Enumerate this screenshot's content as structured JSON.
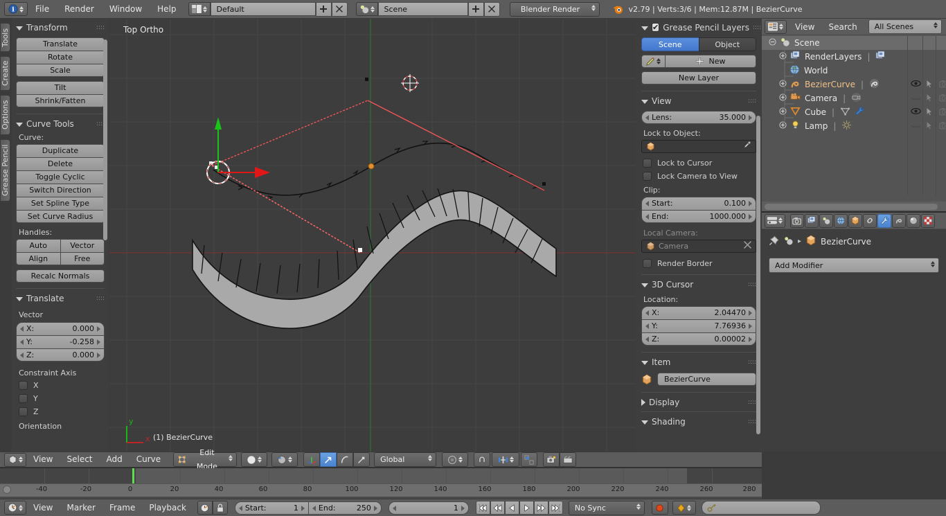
{
  "app": {
    "title": "Blender",
    "version_info": "v2.79 | Verts:3/6 | Mem:12.87M | BezierCurve",
    "logo_icon": "blender-logo-icon"
  },
  "topbar": {
    "editor_type_icon": "info-editor-icon",
    "menus": [
      "File",
      "Render",
      "Window",
      "Help"
    ],
    "screen_layout_icon": "screen-layout-icon",
    "screen_layout": "Default",
    "add_screen_icon": "plus-icon",
    "delete_screen_icon": "x-icon",
    "scene_icon": "scene-icon",
    "scene": "Scene",
    "add_scene_icon": "plus-icon",
    "delete_scene_icon": "x-icon",
    "render_engine": "Blender Render"
  },
  "tool_tabs": [
    "Tools",
    "Create",
    "Options",
    "Grease Pencil"
  ],
  "tool_panel": {
    "transform": {
      "title": "Transform",
      "buttons_group1": [
        "Translate",
        "Rotate",
        "Scale"
      ],
      "buttons_group2": [
        "Tilt",
        "Shrink/Fatten"
      ]
    },
    "curve_tools": {
      "title": "Curve Tools",
      "curve_label": "Curve:",
      "curve_buttons": [
        "Duplicate",
        "Delete",
        "Toggle Cyclic",
        "Switch Direction",
        "Set Spline Type",
        "Set Curve Radius"
      ],
      "handles_label": "Handles:",
      "handle_buttons": [
        "Auto",
        "Vector",
        "Align",
        "Free"
      ],
      "recalc_button": "Recalc Normals"
    },
    "translate": {
      "title": "Translate",
      "vector_label": "Vector",
      "fields": [
        {
          "label": "X:",
          "value": "0.000"
        },
        {
          "label": "Y:",
          "value": "-0.258"
        },
        {
          "label": "Z:",
          "value": "0.000"
        }
      ],
      "constraint_axis_label": "Constraint Axis",
      "axes": [
        {
          "label": "X",
          "checked": false
        },
        {
          "label": "Y",
          "checked": false
        },
        {
          "label": "Z",
          "checked": false
        }
      ],
      "orientation_label": "Orientation"
    }
  },
  "viewport": {
    "view_label": "Top Ortho",
    "object_label": "(1) BezierCurve",
    "axis_gizmo": {
      "x": "x",
      "y": "y"
    },
    "colors": {
      "background": "#3d3d3d",
      "grid": "#454545",
      "x_axis": "#8c3a3a",
      "y_axis": "#3a8c3a",
      "curve": "#101010",
      "mesh_fill": "#a8a8a8",
      "selected_point": "#ffffff",
      "active_point": "#e08a2a",
      "handle_line": "#ff5b5b"
    }
  },
  "npanel": {
    "grease_pencil": {
      "title": "Grease Pencil Layers",
      "checkbox": true,
      "tabs": [
        "Scene",
        "Object"
      ],
      "active_tab": "Scene",
      "pencil_icon": "pencil-icon",
      "new_button": "New",
      "new_layer_button": "New Layer"
    },
    "view": {
      "title": "View",
      "lens": {
        "label": "Lens:",
        "value": "35.000"
      },
      "lock_to_object_label": "Lock to Object:",
      "lock_to_object_value": "",
      "lock_object_icon": "object-cube-icon",
      "eyedropper_icon": "eyedropper-icon",
      "lock_to_cursor": {
        "label": "Lock to Cursor",
        "checked": false
      },
      "lock_camera_to_view": {
        "label": "Lock Camera to View",
        "checked": false
      },
      "clip_label": "Clip:",
      "clip_start": {
        "label": "Start:",
        "value": "0.100"
      },
      "clip_end": {
        "label": "End:",
        "value": "1000.000"
      },
      "local_camera_label": "Local Camera:",
      "local_camera_value": "Camera",
      "render_border": {
        "label": "Render Border",
        "checked": false
      }
    },
    "cursor_3d": {
      "title": "3D Cursor",
      "location_label": "Location:",
      "fields": [
        {
          "label": "X:",
          "value": "2.04470"
        },
        {
          "label": "Y:",
          "value": "7.76936"
        },
        {
          "label": "Z:",
          "value": "0.00002"
        }
      ]
    },
    "item": {
      "title": "Item",
      "object_icon": "object-cube-icon",
      "name": "BezierCurve"
    },
    "display": {
      "title": "Display",
      "collapsed": true
    },
    "shading": {
      "title": "Shading",
      "collapsed": false
    }
  },
  "outliner": {
    "editor_icon": "outliner-icon",
    "menus": [
      "View",
      "Search"
    ],
    "display_mode": "All Scenes",
    "rows": [
      {
        "label": "Scene",
        "icon": "scene-icon",
        "depth": 0,
        "expander": "minus",
        "selected": true,
        "extra_icons": [],
        "restrict": false
      },
      {
        "label": "RenderLayers",
        "icon": "renderlayers-icon",
        "depth": 1,
        "expander": "plus",
        "selected": false,
        "extra_icons": [
          "renderlayers-icon"
        ],
        "restrict": false
      },
      {
        "label": "World",
        "icon": "world-icon",
        "depth": 1,
        "expander": "none",
        "selected": false,
        "extra_icons": [],
        "restrict": false
      },
      {
        "label": "BezierCurve",
        "icon": "curve-icon",
        "depth": 1,
        "expander": "plus",
        "selected": false,
        "extra_icons": [
          "curve-data-icon"
        ],
        "restrict": true,
        "visible": true
      },
      {
        "label": "Camera",
        "icon": "camera-icon",
        "depth": 1,
        "expander": "plus",
        "selected": false,
        "extra_icons": [
          "camera-data-icon"
        ],
        "restrict": true,
        "visible": false
      },
      {
        "label": "Cube",
        "icon": "mesh-icon",
        "depth": 1,
        "expander": "plus",
        "selected": false,
        "extra_icons": [
          "mesh-data-icon",
          "modifier-wrench-icon"
        ],
        "restrict": true,
        "visible": true
      },
      {
        "label": "Lamp",
        "icon": "lamp-icon",
        "depth": 1,
        "expander": "plus",
        "selected": false,
        "extra_icons": [
          "lamp-data-icon"
        ],
        "restrict": true,
        "visible": false
      }
    ],
    "restrict_columns": [
      "eye-icon",
      "cursor-arrow-icon",
      "camera-render-icon"
    ]
  },
  "properties": {
    "editor_icon": "properties-editor-icon",
    "tabs": [
      {
        "name": "render-tab",
        "icon": "camera-back-icon",
        "active": false
      },
      {
        "name": "render-layers-tab",
        "icon": "renderlayers-icon",
        "active": false
      },
      {
        "name": "scene-tab",
        "icon": "scene-icon",
        "active": false
      },
      {
        "name": "world-tab",
        "icon": "world-icon",
        "active": false
      },
      {
        "name": "object-tab",
        "icon": "object-cube-icon",
        "active": false
      },
      {
        "name": "constraints-tab",
        "icon": "chain-link-icon",
        "active": false
      },
      {
        "name": "modifiers-tab",
        "icon": "wrench-icon",
        "active": true
      },
      {
        "name": "data-tab",
        "icon": "curve-data-icon",
        "active": false
      },
      {
        "name": "material-tab",
        "icon": "material-sphere-icon",
        "active": false
      },
      {
        "name": "texture-tab",
        "icon": "checker-texture-icon",
        "active": false
      }
    ],
    "breadcrumb": {
      "pin_icon": "pin-icon",
      "scene_icon": "scene-icon",
      "separator": "▸",
      "object_icon": "object-cube-icon",
      "object_name": "BezierCurve"
    },
    "add_modifier": "Add Modifier"
  },
  "viewport_header": {
    "editor_icon": "3d-view-icon",
    "menus": [
      "View",
      "Select",
      "Add",
      "Curve"
    ],
    "mode_icon": "edit-mode-icon",
    "mode": "Edit Mode",
    "shading_icon": "solid-shading-icon",
    "shading_mode": "Solid",
    "pivot_icon": "pivot-median-icon",
    "manipulator_icons": [
      "translate-manipulator-icon",
      "rotate-manipulator-icon",
      "scale-manipulator-icon"
    ],
    "transform_orientation": "Global",
    "proportional_icon": "proportional-edit-icon",
    "snap_icon": "magnet-icon",
    "snap_element_icon": "snap-increment-icon",
    "snap_target_icon": "snap-target-icon",
    "render_icons": [
      "render-image-icon",
      "render-animation-icon"
    ]
  },
  "timeline": {
    "editor_icon": "timeline-icon",
    "menus": [
      "View",
      "Marker",
      "Frame",
      "Playback"
    ],
    "auto_key_icon": "auto-key-icon",
    "lock_icon": "lock-icon",
    "start": {
      "label": "Start:",
      "value": "1"
    },
    "end": {
      "label": "End:",
      "value": "250"
    },
    "current_frame": "1",
    "transport_icons": [
      "jump-start-icon",
      "prev-keyframe-icon",
      "play-reverse-icon",
      "play-icon",
      "next-keyframe-icon",
      "jump-end-icon"
    ],
    "sync_mode": "No Sync",
    "record_icon": "record-icon",
    "keyframe_type_icon": "keyframe-diamond-icon",
    "keying_set_icon": "keying-set-icon",
    "keying_set_value": "",
    "ruler_ticks": [
      "-40",
      "-20",
      "0",
      "20",
      "40",
      "60",
      "80",
      "100",
      "120",
      "140",
      "160",
      "180",
      "200",
      "220",
      "240",
      "260",
      "280"
    ],
    "playhead_frame": 1
  }
}
